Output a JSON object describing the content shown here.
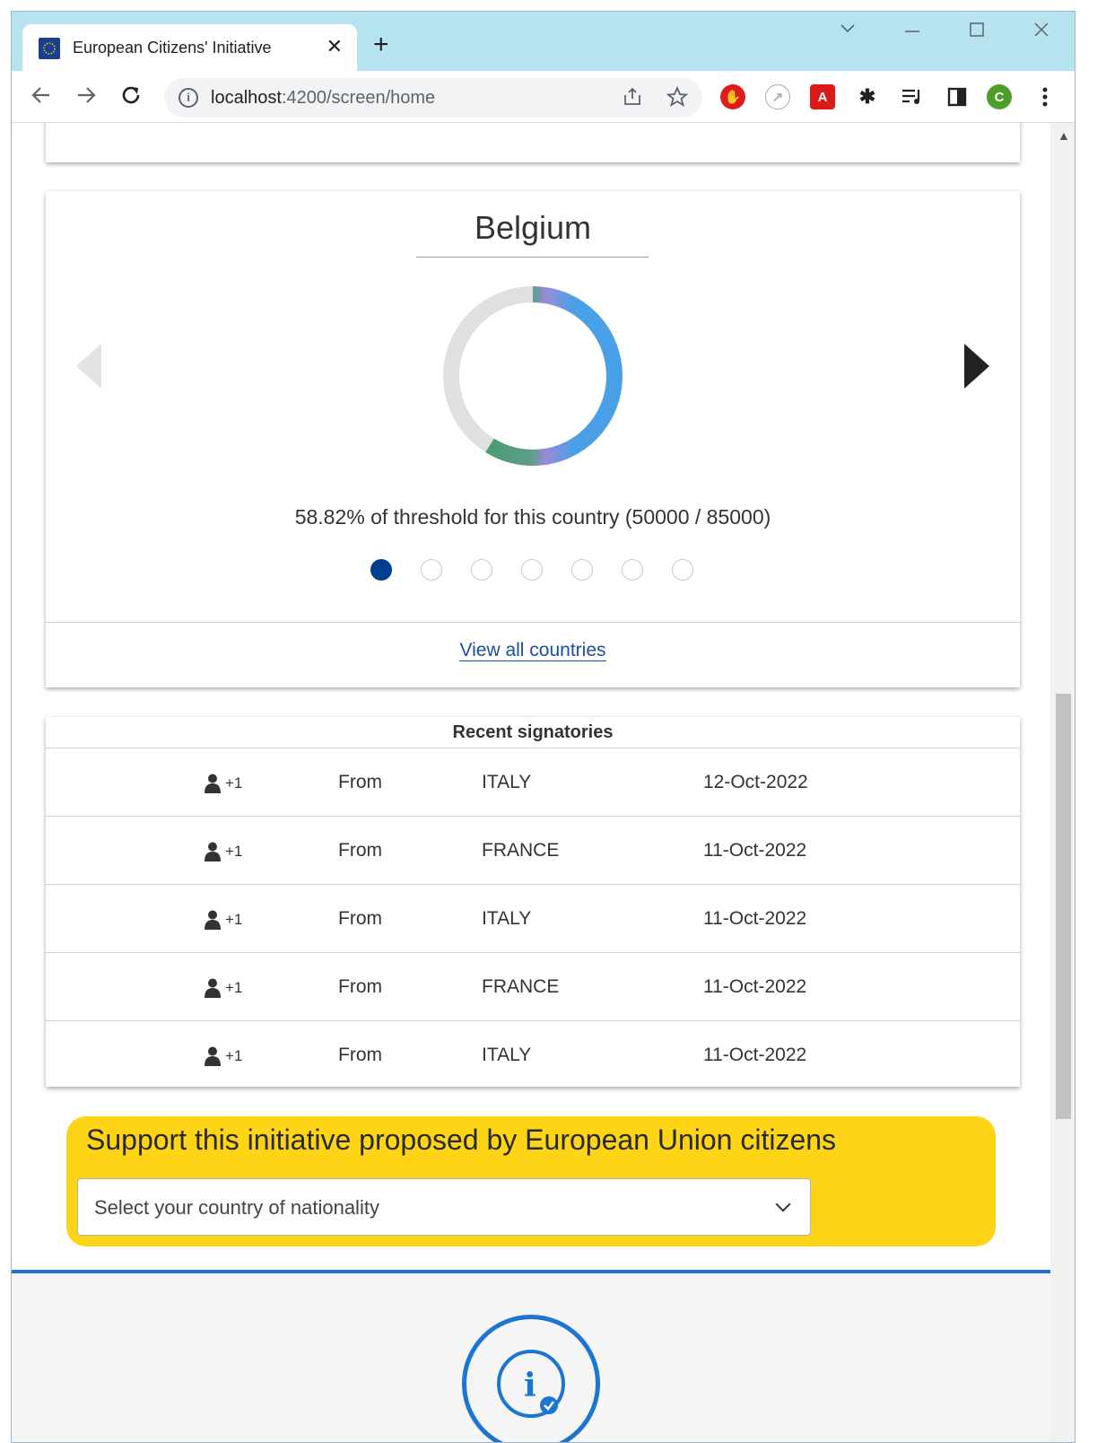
{
  "browser": {
    "tab_title": "European Citizens' Initiative",
    "tab_close": "✕",
    "new_tab": "+",
    "url_host": "localhost",
    "url_path": ":4200/screen/home",
    "profile_initial": "C",
    "angular_ext": "A"
  },
  "country_card": {
    "country": "Belgium",
    "threshold_text": "58.82% of threshold for this country (50000 / 85000)",
    "progress_fraction": 0.5882,
    "slide_count": 7,
    "active_slide": 0,
    "view_all_label": "View all countries",
    "colors": {
      "progress_start": "#3a9a5e",
      "progress_end": "#4aa0e6",
      "track": "#e0e0e0",
      "active_dot": "#003f8f"
    }
  },
  "recent": {
    "title": "Recent signatories",
    "rows": [
      {
        "count": "+1",
        "from": "From",
        "country": "ITALY",
        "date": "12-Oct-2022"
      },
      {
        "count": "+1",
        "from": "From",
        "country": "FRANCE",
        "date": "11-Oct-2022"
      },
      {
        "count": "+1",
        "from": "From",
        "country": "ITALY",
        "date": "11-Oct-2022"
      },
      {
        "count": "+1",
        "from": "From",
        "country": "FRANCE",
        "date": "11-Oct-2022"
      },
      {
        "count": "+1",
        "from": "From",
        "country": "ITALY",
        "date": "11-Oct-2022"
      }
    ]
  },
  "support": {
    "title": "Support this initiative proposed by European Union citizens",
    "select_placeholder": "Select your country of nationality",
    "color": "#fdd516"
  },
  "footer": {
    "accent": "#1b75d1",
    "icon": "info-check-icon"
  }
}
